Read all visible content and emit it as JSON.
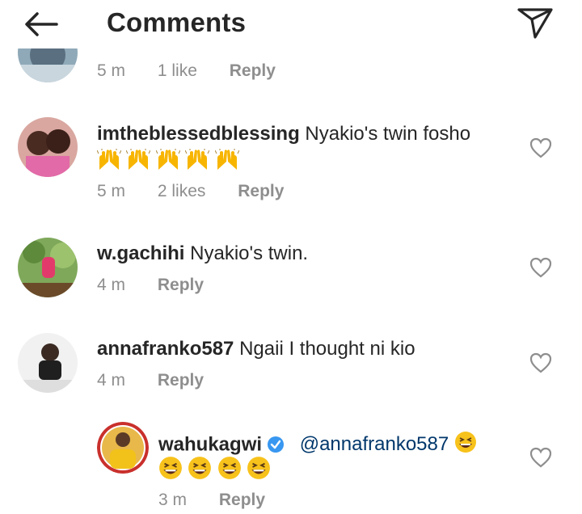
{
  "header": {
    "title": "Comments"
  },
  "comments": [
    {
      "username": "",
      "text": "",
      "time": "5 m",
      "likes": "1 like",
      "reply": "Reply"
    },
    {
      "username": "imtheblessedblessing",
      "text": "Nyakio's twin fosho",
      "time": "5 m",
      "likes": "2 likes",
      "reply": "Reply",
      "emoji": "raising-hands",
      "emoji_count": 5
    },
    {
      "username": "w.gachihi",
      "text": "Nyakio's twin.",
      "time": "4 m",
      "reply": "Reply"
    },
    {
      "username": "annafranko587",
      "text": "Ngaii I thought ni kio",
      "time": "4 m",
      "reply": "Reply"
    }
  ],
  "reply_thread": {
    "username": "wahukagwi",
    "verified": true,
    "mention": "@annafranko587",
    "emoji": "grinning-squinting-face",
    "emoji_count": 5,
    "time": "3 m",
    "reply": "Reply"
  },
  "colors": {
    "text": "#262626",
    "meta": "#8e8e8e",
    "mention": "#00376b",
    "verified": "#3897f0"
  }
}
